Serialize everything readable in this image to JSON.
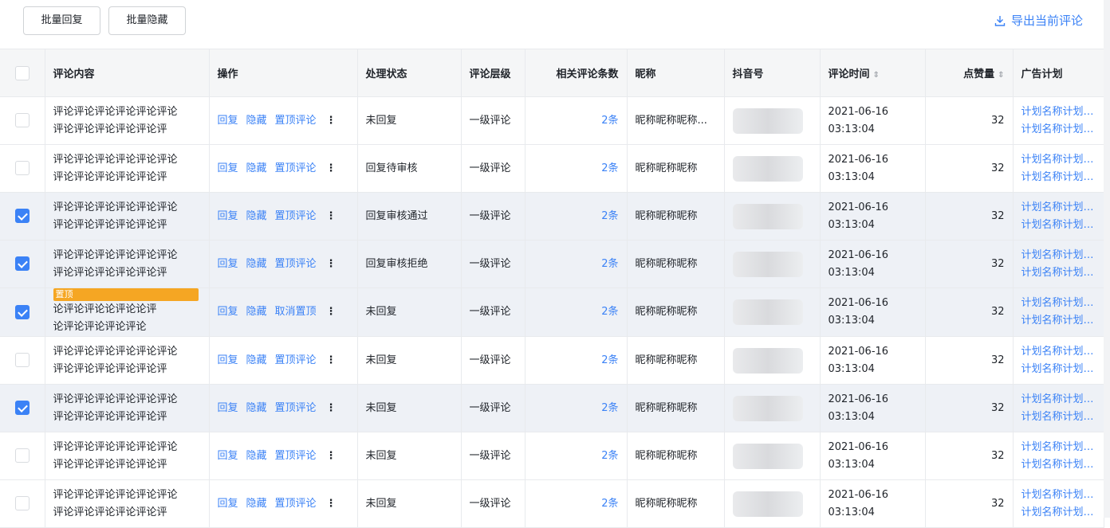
{
  "toolbar": {
    "batch_reply": "批量回复",
    "batch_hide": "批量隐藏",
    "export": "导出当前评论"
  },
  "columns": {
    "content": "评论内容",
    "ops": "操作",
    "status": "处理状态",
    "level": "评论层级",
    "related": "相关评论条数",
    "nickname": "昵称",
    "douyin": "抖音号",
    "time": "评论时间",
    "likes": "点赞量",
    "plan": "广告计划"
  },
  "ops": {
    "reply": "回复",
    "hide": "隐藏",
    "more": "⋮"
  },
  "pin_badge": "置顶",
  "rows": [
    {
      "checked": false,
      "pinned": false,
      "line1": "评论评论评论评论评论评论",
      "line2": "评论评论评论评论评论评",
      "pin_op": "置顶评论",
      "status": "未回复",
      "level": "一级评论",
      "related": "2条",
      "nickname": "昵称昵称昵称...",
      "date": "2021-06-16",
      "time": "03:13:04",
      "likes": "32",
      "plan1": "计划名称计划名称",
      "plan2": "计划名称计划名..."
    },
    {
      "checked": false,
      "pinned": false,
      "line1": "评论评论评论评论评论评论",
      "line2": "评论评论评论评论评论评",
      "pin_op": "置顶评论",
      "status": "回复待审核",
      "level": "一级评论",
      "related": "2条",
      "nickname": "昵称昵称昵称",
      "date": "2021-06-16",
      "time": "03:13:04",
      "likes": "32",
      "plan1": "计划名称计划名称",
      "plan2": "计划名称计划名..."
    },
    {
      "checked": true,
      "pinned": false,
      "line1": "评论评论评论评论评论评论",
      "line2": "评论评论评论评论评论评",
      "pin_op": "置顶评论",
      "status": "回复审核通过",
      "level": "一级评论",
      "related": "2条",
      "nickname": "昵称昵称昵称",
      "date": "2021-06-16",
      "time": "03:13:04",
      "likes": "32",
      "plan1": "计划名称计划名称",
      "plan2": "计划名称计划名..."
    },
    {
      "checked": true,
      "pinned": false,
      "line1": "评论评论评论评论评论评论",
      "line2": "评论评论评论评论评论评",
      "pin_op": "置顶评论",
      "status": "回复审核拒绝",
      "level": "一级评论",
      "related": "2条",
      "nickname": "昵称昵称昵称",
      "date": "2021-06-16",
      "time": "03:13:04",
      "likes": "32",
      "plan1": "计划名称计划名称",
      "plan2": "计划名称计划名..."
    },
    {
      "checked": true,
      "pinned": true,
      "line1": "论评论评论论评论论评",
      "line2": "论评论评论评论评论",
      "pin_op": "取消置顶",
      "status": "未回复",
      "level": "一级评论",
      "related": "2条",
      "nickname": "昵称昵称昵称",
      "date": "2021-06-16",
      "time": "03:13:04",
      "likes": "32",
      "plan1": "计划名称计划名称",
      "plan2": "计划名称计划名..."
    },
    {
      "checked": false,
      "pinned": false,
      "line1": "评论评论评论评论评论评论",
      "line2": "评论评论评论评论评论评",
      "pin_op": "置顶评论",
      "status": "未回复",
      "level": "一级评论",
      "related": "2条",
      "nickname": "昵称昵称昵称",
      "date": "2021-06-16",
      "time": "03:13:04",
      "likes": "32",
      "plan1": "计划名称计划名称",
      "plan2": "计划名称计划名..."
    },
    {
      "checked": true,
      "pinned": false,
      "line1": "评论评论评论评论评论评论",
      "line2": "评论评论评论评论评论评",
      "pin_op": "置顶评论",
      "status": "未回复",
      "level": "一级评论",
      "related": "2条",
      "nickname": "昵称昵称昵称",
      "date": "2021-06-16",
      "time": "03:13:04",
      "likes": "32",
      "plan1": "计划名称计划名称",
      "plan2": "计划名称计划名..."
    },
    {
      "checked": false,
      "pinned": false,
      "line1": "评论评论评论评论评论评论",
      "line2": "评论评论评论评论评论评",
      "pin_op": "置顶评论",
      "status": "未回复",
      "level": "一级评论",
      "related": "2条",
      "nickname": "昵称昵称昵称",
      "date": "2021-06-16",
      "time": "03:13:04",
      "likes": "32",
      "plan1": "计划名称计划名称",
      "plan2": "计划名称计划名..."
    },
    {
      "checked": false,
      "pinned": false,
      "line1": "评论评论评论评论评论评论",
      "line2": "评论评论评论评论评论评",
      "pin_op": "置顶评论",
      "status": "未回复",
      "level": "一级评论",
      "related": "2条",
      "nickname": "昵称昵称昵称",
      "date": "2021-06-16",
      "time": "03:13:04",
      "likes": "32",
      "plan1": "计划名称计划名称",
      "plan2": "计划名称计划名..."
    }
  ],
  "colors": {
    "accent": "#3b82f6",
    "pin_badge": "#f5a623",
    "selected_row": "#eef1f6"
  },
  "icons": {
    "export": "download-icon",
    "sort": "sort-icon",
    "more": "more-vertical-icon"
  }
}
